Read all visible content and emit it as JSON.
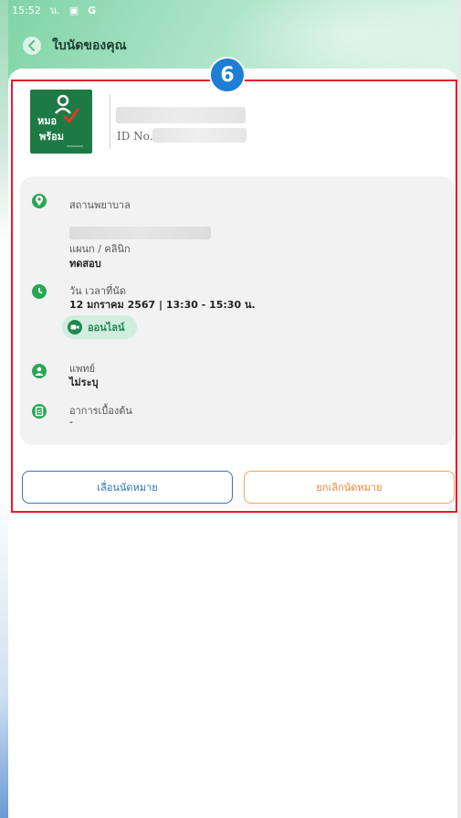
{
  "status_bar": {
    "time": "15:52",
    "suffix": "น.",
    "icons": [
      "notification-square-icon",
      "google-g-icon"
    ]
  },
  "header": {
    "title": "ใบนัดของคุณ",
    "back_icon": "chevron-left-icon"
  },
  "annotation": {
    "step_number": "6",
    "badge_color": "#1e7ed6",
    "highlight_color": "#e0202a"
  },
  "hospital": {
    "logo_text_top": "หมอ",
    "logo_text_bottom": "พร้อม",
    "id_label": "ID No."
  },
  "appointment": {
    "hospital_label": "สถานพยาบาล",
    "department_label": "แผนก / คลินิก",
    "department_value": "ทดสอบ",
    "datetime_label": "วัน เวลาที่นัด",
    "datetime_value": "12 มกราคม 2567 | 13:30 - 15:30 น.",
    "online_label": "ออนไลน์",
    "doctor_label": "แพทย์",
    "doctor_value": "ไม่ระบุ",
    "symptom_label": "อาการเบื้องต้น",
    "symptom_value": "-"
  },
  "actions": {
    "postpone_label": "เลื่อนนัดหมาย",
    "cancel_label": "ยกเลิกนัดหมาย"
  },
  "colors": {
    "accent_green": "#2aa655",
    "header_green": "#7fd4a6",
    "postpone_blue": "#2e74b5",
    "cancel_orange": "#e8863a"
  }
}
